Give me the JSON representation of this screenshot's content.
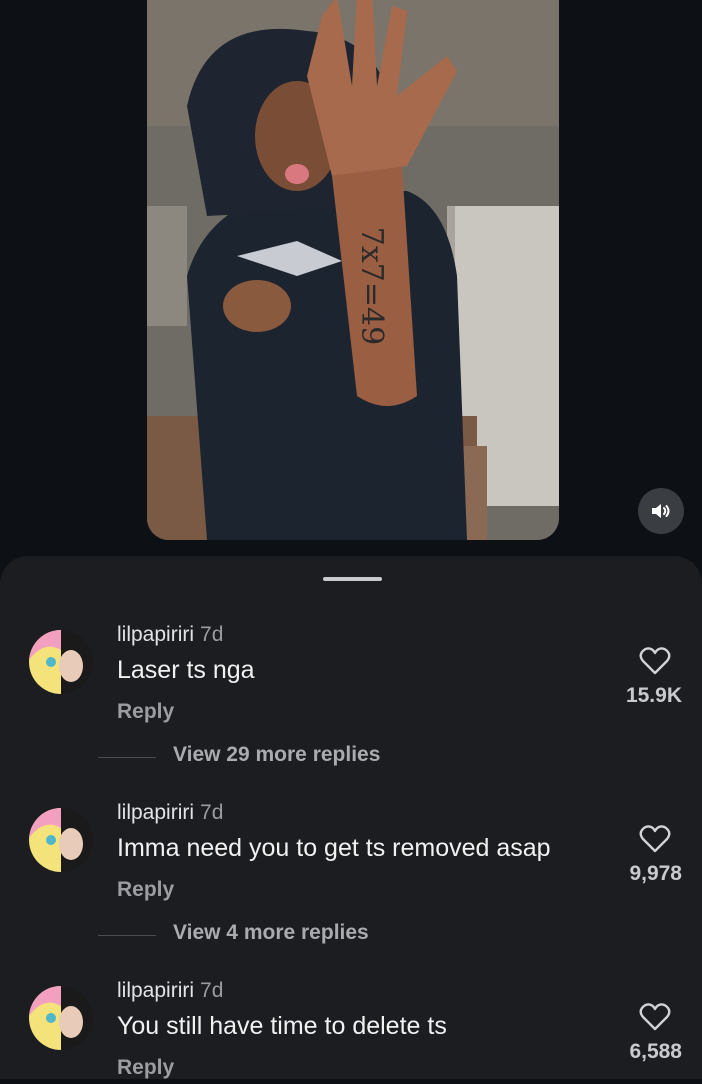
{
  "video": {
    "tattoo_text": "7x7=49",
    "mute_icon": "speaker-icon"
  },
  "comments": [
    {
      "username": "lilpapiriri",
      "time": "7d",
      "text": "Laser ts nga",
      "reply_label": "Reply",
      "likes": "15.9K",
      "view_more": "View 29 more replies"
    },
    {
      "username": "lilpapiriri",
      "time": "7d",
      "text": "Imma need you to get ts removed asap",
      "reply_label": "Reply",
      "likes": "9,978",
      "view_more": "View 4 more replies"
    },
    {
      "username": "lilpapiriri",
      "time": "7d",
      "text": "You still have time to delete ts",
      "reply_label": "Reply",
      "likes": "6,588"
    }
  ],
  "colors": {
    "background": "#0d1014",
    "sheet": "#1b1d21",
    "muted_text": "#9b9da1"
  }
}
